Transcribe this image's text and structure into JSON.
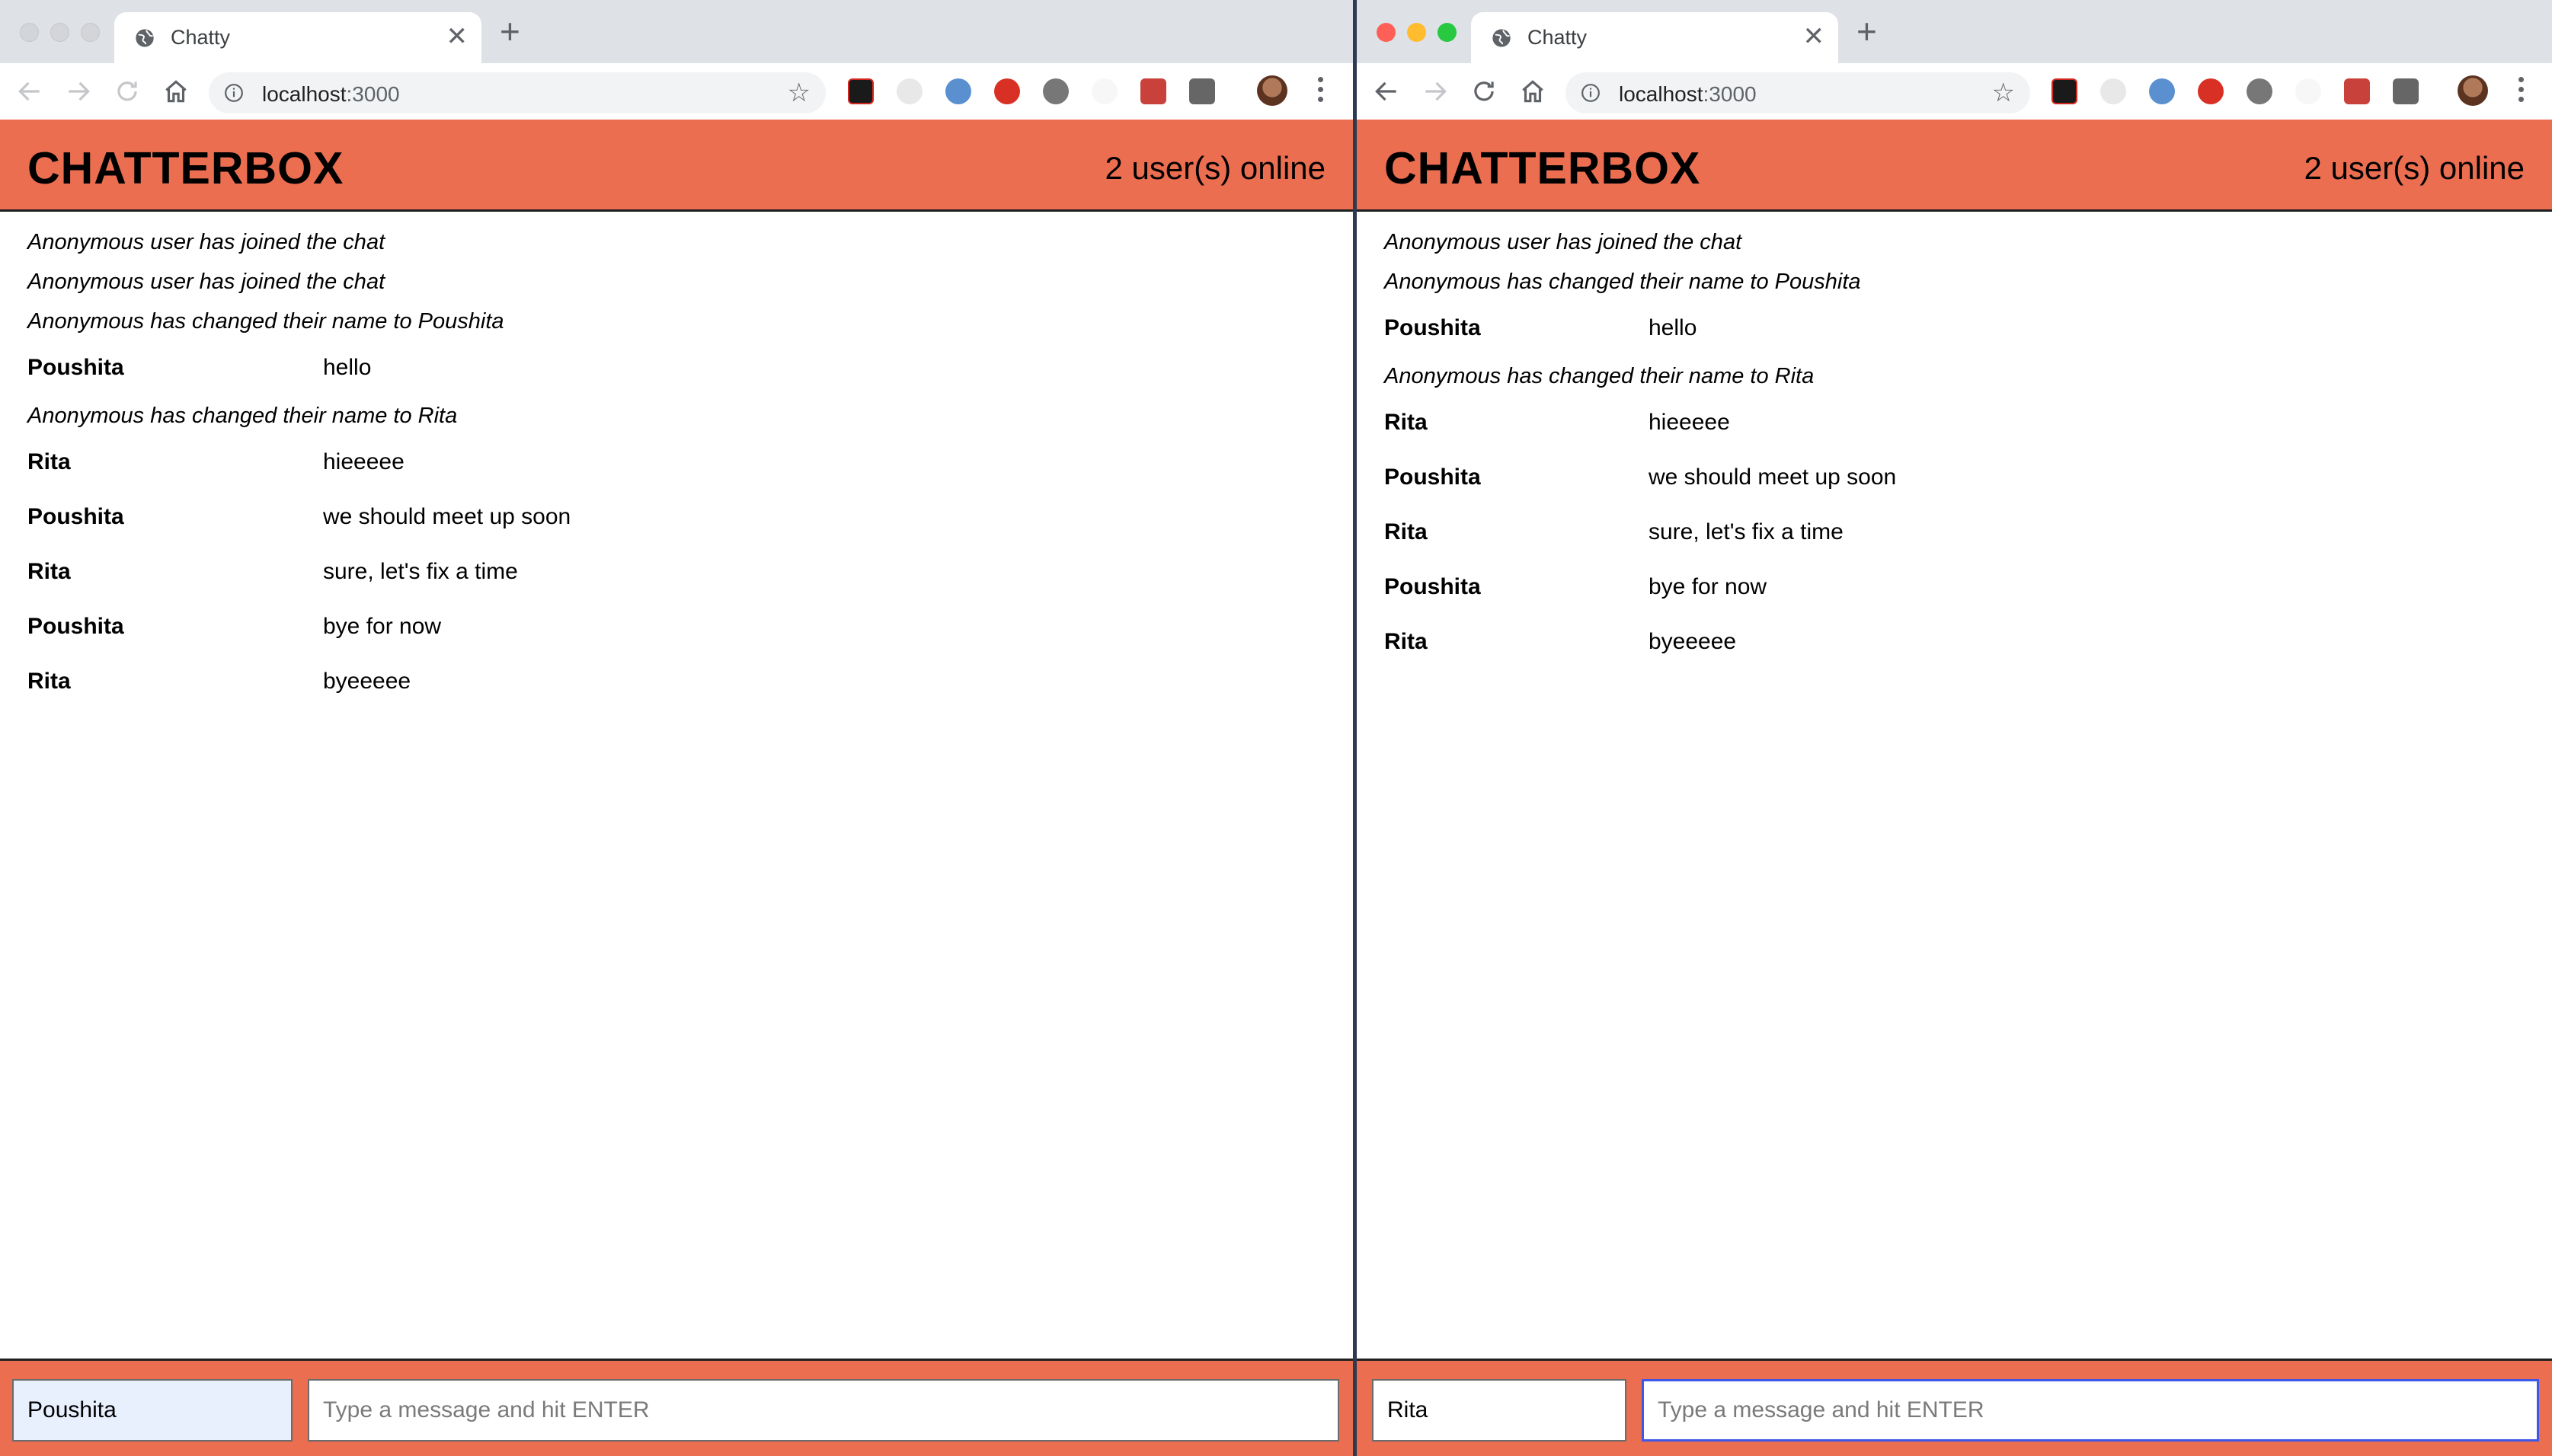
{
  "browser": {
    "tab_title": "Chatty",
    "url_host": "localhost",
    "url_port": ":3000"
  },
  "app": {
    "brand": "CHATTERBOX",
    "online_count": "2 user(s) online",
    "message_placeholder": "Type a message and hit ENTER",
    "accent_color": "#ec6e51"
  },
  "left_window": {
    "username": "Poushita",
    "messages": [
      {
        "type": "system",
        "text": "Anonymous user has joined the chat"
      },
      {
        "type": "system",
        "text": "Anonymous user has joined the chat"
      },
      {
        "type": "system",
        "text": "Anonymous has changed their name to Poushita"
      },
      {
        "type": "chat",
        "user": "Poushita",
        "text": "hello"
      },
      {
        "type": "system",
        "text": "Anonymous has changed their name to Rita"
      },
      {
        "type": "chat",
        "user": "Rita",
        "text": "hieeeee"
      },
      {
        "type": "chat",
        "user": "Poushita",
        "text": "we should meet up soon"
      },
      {
        "type": "chat",
        "user": "Rita",
        "text": "sure, let's fix a time"
      },
      {
        "type": "chat",
        "user": "Poushita",
        "text": "bye for now"
      },
      {
        "type": "chat",
        "user": "Rita",
        "text": "byeeeee"
      }
    ]
  },
  "right_window": {
    "username": "Rita",
    "messages": [
      {
        "type": "system",
        "text": "Anonymous user has joined the chat"
      },
      {
        "type": "system",
        "text": "Anonymous has changed their name to Poushita"
      },
      {
        "type": "chat",
        "user": "Poushita",
        "text": "hello"
      },
      {
        "type": "system",
        "text": "Anonymous has changed their name to Rita"
      },
      {
        "type": "chat",
        "user": "Rita",
        "text": "hieeeee"
      },
      {
        "type": "chat",
        "user": "Poushita",
        "text": "we should meet up soon"
      },
      {
        "type": "chat",
        "user": "Rita",
        "text": "sure, let's fix a time"
      },
      {
        "type": "chat",
        "user": "Poushita",
        "text": "bye for now"
      },
      {
        "type": "chat",
        "user": "Rita",
        "text": "byeeeee"
      }
    ]
  },
  "extensions": [
    "acrobat-icon",
    "moon-icon",
    "lens-icon",
    "stop-icon",
    "spiral-icon",
    "blank-icon",
    "puzzle-icon",
    "facebook-icon"
  ]
}
